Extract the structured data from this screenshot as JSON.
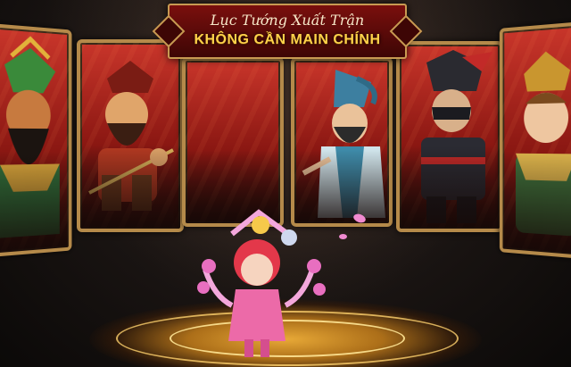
{
  "banner": {
    "line1": "Lục Tướng Xuất Trận",
    "line2": "KHÔNG CẦN MAIN CHÍNH"
  },
  "colors": {
    "frame_gold": "#b58a4a",
    "card_red": "#c8352a",
    "title_text": "#ffd24a",
    "floor_glow": "#f3b23a"
  },
  "heroes": [
    {
      "slot": 1,
      "occupied": true
    },
    {
      "slot": 2,
      "occupied": true
    },
    {
      "slot": 3,
      "occupied": false
    },
    {
      "slot": 4,
      "occupied": true
    },
    {
      "slot": 5,
      "occupied": true
    },
    {
      "slot": 6,
      "occupied": true
    }
  ]
}
